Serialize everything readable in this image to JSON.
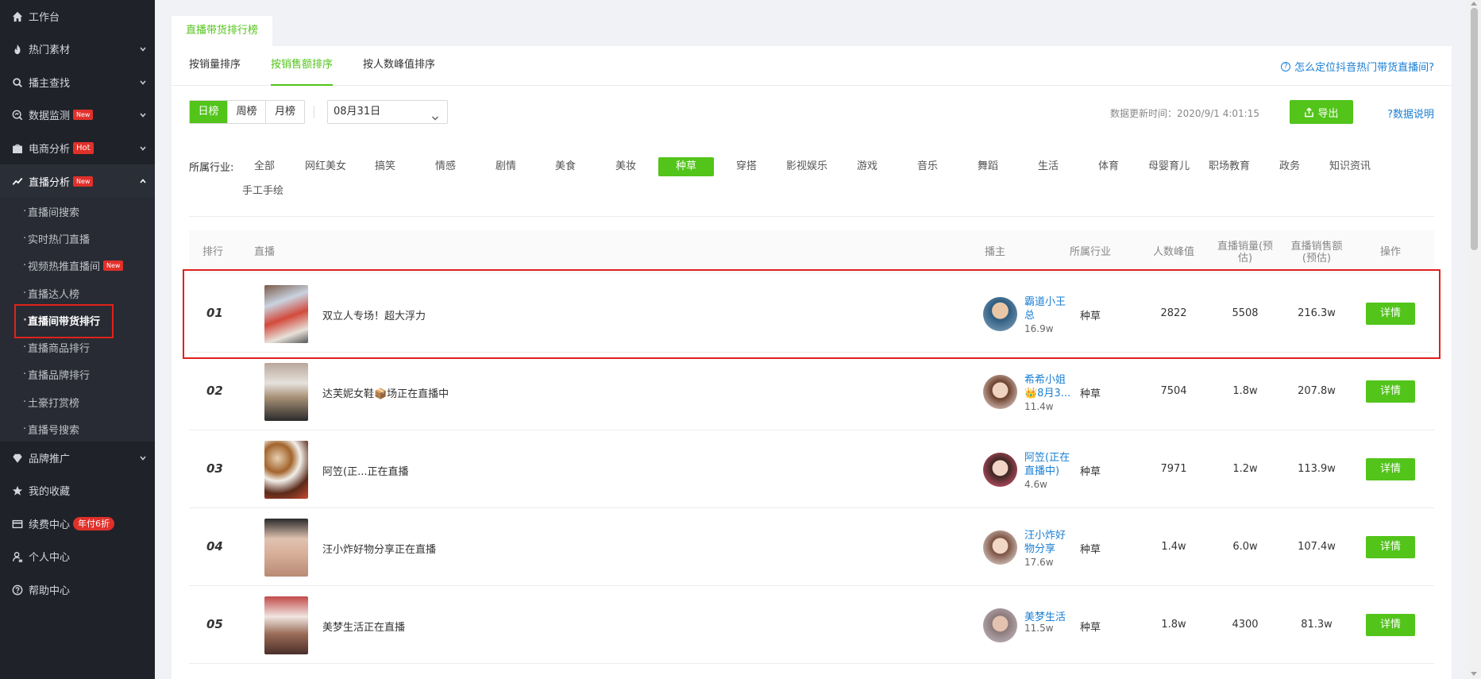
{
  "sidebar": {
    "items": [
      {
        "label": "工作台",
        "icon": "home-icon",
        "chevron": false
      },
      {
        "label": "热门素材",
        "icon": "fire-icon",
        "chevron": true
      },
      {
        "label": "播主查找",
        "icon": "search-icon",
        "chevron": true
      },
      {
        "label": "数据监测",
        "icon": "monitor-icon",
        "chevron": true,
        "badge": "New"
      },
      {
        "label": "电商分析",
        "icon": "shop-icon",
        "chevron": true,
        "badge_hot": "Hot"
      },
      {
        "label": "直播分析",
        "icon": "trend-icon",
        "chevron": true,
        "badge": "New"
      }
    ],
    "sub_items": [
      {
        "label": "直播间搜索"
      },
      {
        "label": "实时热门直播"
      },
      {
        "label": "视频热推直播间",
        "badge": "New"
      },
      {
        "label": "直播达人榜"
      },
      {
        "label": "直播间带货排行"
      },
      {
        "label": "直播商品排行"
      },
      {
        "label": "直播品牌排行"
      },
      {
        "label": "土豪打赏榜"
      },
      {
        "label": "直播号搜索"
      }
    ],
    "bottom_items": [
      {
        "label": "品牌推广",
        "icon": "diamond-icon",
        "chevron": true
      },
      {
        "label": "我的收藏",
        "icon": "star-icon"
      },
      {
        "label": "续费中心",
        "icon": "card-icon",
        "badge_pill": "年付6折"
      },
      {
        "label": "个人中心",
        "icon": "user-icon"
      },
      {
        "label": "帮助中心",
        "icon": "help-icon"
      }
    ]
  },
  "header": {
    "top_tab": "直播带货排行榜",
    "sub_tabs": [
      "按销量排序",
      "按销售额排序",
      "按人数峰值排序"
    ],
    "help_link": "怎么定位抖音热门带货直播间?"
  },
  "filters": {
    "periods": [
      "日榜",
      "周榜",
      "月榜"
    ],
    "date": "08月31日",
    "update_time": "数据更新时间：2020/9/1 4:01:15",
    "export_label": "导出",
    "explain_label": "?数据说明",
    "industry_label": "所属行业:",
    "industries": [
      "全部",
      "网红美女",
      "搞笑",
      "情感",
      "剧情",
      "美食",
      "美妆",
      "种草",
      "穿搭",
      "影视娱乐",
      "游戏",
      "音乐",
      "舞蹈",
      "生活",
      "体育",
      "母婴育儿",
      "职场教育",
      "政务",
      "知识资讯",
      "手工手绘"
    ],
    "active_industry": "种草"
  },
  "table": {
    "headers": {
      "rank": "排行",
      "live": "直播",
      "host": "播主",
      "industry": "所属行业",
      "peak": "人数峰值",
      "sales_qty": "直播销量(预估)",
      "sales_amount": "直播销售额(预估)",
      "action": "操作"
    },
    "rows": [
      {
        "rank": "01",
        "title": "双立人专场！超大浮力",
        "host_line1": "霸道小王",
        "host_line2": "总",
        "fans": "16.9w",
        "industry": "种草",
        "peak": "2822",
        "qty": "5508",
        "amount": "216.3w",
        "action": "详情"
      },
      {
        "rank": "02",
        "title": "达芙妮女鞋📦场正在直播中",
        "host_line1": "希希小姐",
        "host_line2": "👑8月3...",
        "fans": "11.4w",
        "industry": "种草",
        "peak": "7504",
        "qty": "1.8w",
        "amount": "207.8w",
        "action": "详情"
      },
      {
        "rank": "03",
        "title": "阿笠(正...正在直播",
        "host_line1": "阿笠(正在",
        "host_line2": "直播中)",
        "fans": "4.6w",
        "industry": "种草",
        "peak": "7971",
        "qty": "1.2w",
        "amount": "113.9w",
        "action": "详情"
      },
      {
        "rank": "04",
        "title": "汪小炸好物分享正在直播",
        "host_line1": "汪小炸好",
        "host_line2": "物分享",
        "fans": "17.6w",
        "industry": "种草",
        "peak": "1.4w",
        "qty": "6.0w",
        "amount": "107.4w",
        "action": "详情"
      },
      {
        "rank": "05",
        "title": "美梦生活正在直播",
        "host_line1": "美梦生活",
        "host_line2": "",
        "fans": "11.5w",
        "industry": "种草",
        "peak": "1.8w",
        "qty": "4300",
        "amount": "81.3w",
        "action": "详情"
      }
    ]
  },
  "colors": {
    "accent": "#52c41a",
    "link": "#1a7fd4",
    "highlight": "#e0211b",
    "sidebar_bg": "#1f2229"
  }
}
